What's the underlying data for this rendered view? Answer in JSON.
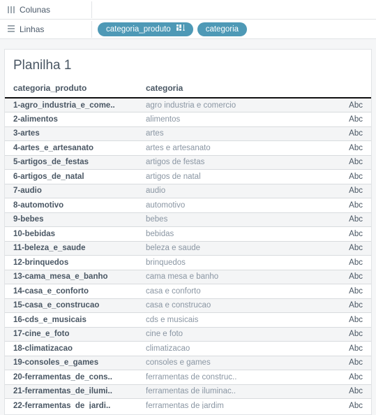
{
  "shelves": {
    "columns_label": "Colunas",
    "rows_label": "Linhas",
    "row_pills": [
      {
        "label": "categoria_produto",
        "sort": true
      },
      {
        "label": "categoria",
        "sort": false
      }
    ]
  },
  "worksheet": {
    "title": "Planilha 1",
    "headers": {
      "col0": "categoria_produto",
      "col1": "categoria"
    },
    "abc_label": "Abc",
    "rows": [
      {
        "p": "1-agro_industria_e_come..",
        "c": "agro industria e comercio"
      },
      {
        "p": "2-alimentos",
        "c": "alimentos"
      },
      {
        "p": "3-artes",
        "c": "artes"
      },
      {
        "p": "4-artes_e_artesanato",
        "c": "artes e artesanato"
      },
      {
        "p": "5-artigos_de_festas",
        "c": "artigos de festas"
      },
      {
        "p": "6-artigos_de_natal",
        "c": "artigos de natal"
      },
      {
        "p": "7-audio",
        "c": "audio"
      },
      {
        "p": "8-automotivo",
        "c": "automotivo"
      },
      {
        "p": "9-bebes",
        "c": "bebes"
      },
      {
        "p": "10-bebidas",
        "c": "bebidas"
      },
      {
        "p": "11-beleza_e_saude",
        "c": "beleza e saude"
      },
      {
        "p": "12-brinquedos",
        "c": "brinquedos"
      },
      {
        "p": "13-cama_mesa_e_banho",
        "c": "cama mesa e banho"
      },
      {
        "p": "14-casa_e_conforto",
        "c": "casa e conforto"
      },
      {
        "p": "15-casa_e_construcao",
        "c": "casa e construcao"
      },
      {
        "p": "16-cds_e_musicais",
        "c": "cds e musicais"
      },
      {
        "p": "17-cine_e_foto",
        "c": "cine e foto"
      },
      {
        "p": "18-climatizacao",
        "c": "climatizacao"
      },
      {
        "p": "19-consoles_e_games",
        "c": "consoles e games"
      },
      {
        "p": "20-ferramentas_de_cons..",
        "c": "ferramentas de construc.."
      },
      {
        "p": "21-ferramentas_de_ilumi..",
        "c": "ferramentas de iluminac.."
      },
      {
        "p": "22-ferramentas_de_jardi..",
        "c": "ferramentas de jardim"
      }
    ]
  }
}
